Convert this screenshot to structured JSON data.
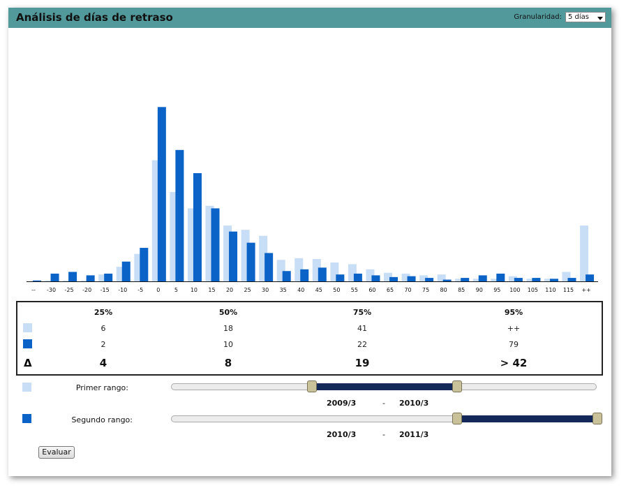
{
  "window": {
    "title": "Análisis de días de retraso",
    "granularity_label": "Granularidad:",
    "granularity_value": "5 días"
  },
  "colors": {
    "header_bg": "#52999b",
    "series1": "#c8def7",
    "series2": "#0b63c7",
    "slider_fill": "#14295a",
    "slider_handle": "#c9c19a"
  },
  "chart_data": {
    "type": "bar",
    "categories": [
      "--",
      "-30",
      "-25",
      "-20",
      "-15",
      "-10",
      "-5",
      "0",
      "5",
      "10",
      "15",
      "20",
      "25",
      "30",
      "35",
      "40",
      "45",
      "50",
      "55",
      "60",
      "65",
      "70",
      "75",
      "80",
      "85",
      "90",
      "95",
      "100",
      "105",
      "110",
      "115",
      "++"
    ],
    "series": [
      {
        "values": [
          0,
          1,
          1,
          1,
          8,
          17,
          32,
          141,
          104,
          85,
          88,
          65,
          60,
          53,
          25,
          27,
          26,
          22,
          20,
          14,
          10,
          9,
          7,
          8,
          3,
          3,
          3,
          6,
          3,
          3,
          11,
          65
        ]
      },
      {
        "values": [
          1,
          9,
          11,
          7,
          9,
          23,
          39,
          203,
          153,
          126,
          85,
          58,
          45,
          33,
          12,
          14,
          16,
          8,
          9,
          7,
          5,
          6,
          4,
          2,
          4,
          7,
          9,
          4,
          4,
          3,
          4,
          8
        ]
      }
    ],
    "xlabel": "",
    "ylabel": "",
    "grid": false,
    "legend": "none"
  },
  "percentiles": {
    "headers": [
      "25%",
      "50%",
      "75%",
      "95%"
    ],
    "row1": [
      "6",
      "18",
      "41",
      "++"
    ],
    "row2": [
      "2",
      "10",
      "22",
      "79"
    ],
    "delta_symbol": "Δ",
    "delta": [
      "4",
      "8",
      "19",
      "> 42"
    ]
  },
  "ranges": {
    "first": {
      "label": "Primer rango:",
      "from": "2009/3",
      "to": "2010/3",
      "fill_start": 0.33,
      "fill_end": 0.67
    },
    "second": {
      "label": "Segundo rango:",
      "from": "2010/3",
      "to": "2011/3",
      "fill_start": 0.67,
      "fill_end": 1.0
    },
    "dash": "-"
  },
  "evaluate_label": "Evaluar"
}
